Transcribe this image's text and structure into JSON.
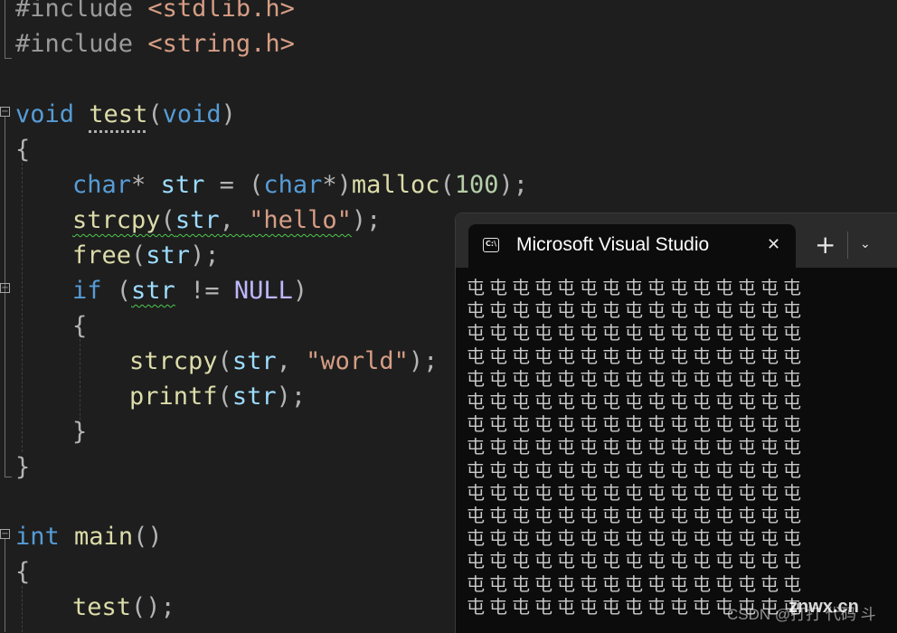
{
  "code": {
    "l1": [
      "#include",
      " ",
      "<stdlib.h>"
    ],
    "l2": [
      "#include",
      " ",
      "<string.h>"
    ],
    "l4": [
      "void",
      " ",
      "test",
      "(",
      "void",
      ")"
    ],
    "l5": [
      "{"
    ],
    "l6": [
      "char",
      "*",
      " ",
      "str",
      " = (",
      "char",
      "*)",
      "malloc",
      "(",
      "100",
      ");"
    ],
    "l7": [
      "strcpy",
      "(",
      "str",
      ", ",
      "\"hello\"",
      ");"
    ],
    "l8": [
      "free",
      "(",
      "str",
      ");"
    ],
    "l9": [
      "if",
      " (",
      "str",
      " != ",
      "NULL",
      ")"
    ],
    "l10": [
      "{"
    ],
    "l11": [
      "strcpy",
      "(",
      "str",
      ", ",
      "\"world\"",
      ");"
    ],
    "l12": [
      "printf",
      "(",
      "str",
      ");"
    ],
    "l13": [
      "}"
    ],
    "l14": [
      "}"
    ],
    "l16": [
      "int",
      " ",
      "main",
      "()"
    ],
    "l17": [
      "{"
    ],
    "l18": [
      "test",
      "();"
    ]
  },
  "fold_glyph": "−",
  "terminal": {
    "title": "Microsoft Visual Studio",
    "icon_text": "C:\\",
    "close_glyph": "✕",
    "new_tab_glyph": "+",
    "dropdown_glyph": "⌄",
    "output_char": "屯",
    "output_cols": 15,
    "output_rows": 15
  },
  "watermark": {
    "text": "CSDN @打打 代码 斗",
    "site": "znwx.cn"
  },
  "colors": {
    "editor_bg": "#1e1e1e",
    "keyword": "#569cd6",
    "function": "#dcdcaa",
    "variable": "#9cdcfe",
    "string": "#d69d85",
    "number": "#b5cea8",
    "macro": "#beb7ff",
    "terminal_bg": "#0c0c0c",
    "tab_strip": "#2b2b2b",
    "squiggle": "#4ec94e"
  }
}
